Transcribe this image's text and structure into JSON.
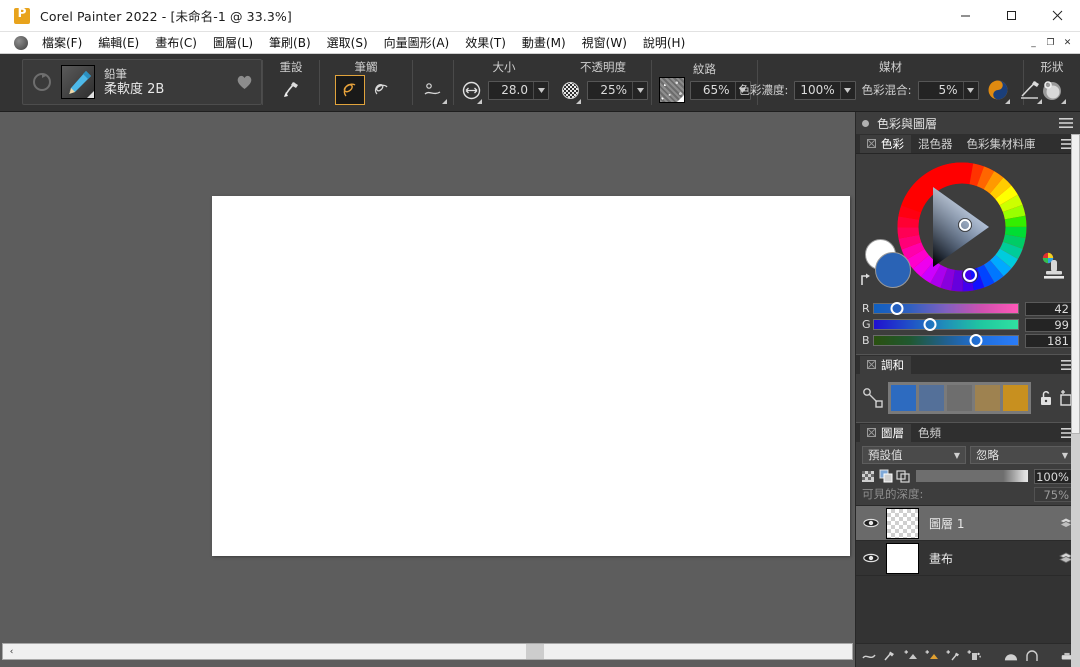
{
  "window": {
    "title": "Corel Painter 2022 - [未命名-1 @ 33.3%]",
    "logo_icon": "corel-painter-logo-icon",
    "minimize_label": "最小化",
    "maximize_label": "最大化",
    "close_label": "關閉",
    "doc_minimize": "_",
    "doc_restore": "❐",
    "doc_close": "✕"
  },
  "menubar": {
    "icon": "painter-document-icon",
    "items": [
      {
        "label": "檔案(F)"
      },
      {
        "label": "編輯(E)"
      },
      {
        "label": "畫布(C)"
      },
      {
        "label": "圖層(L)"
      },
      {
        "label": "筆刷(B)"
      },
      {
        "label": "選取(S)"
      },
      {
        "label": "向量圖形(A)"
      },
      {
        "label": "效果(T)"
      },
      {
        "label": "動畫(M)"
      },
      {
        "label": "視窗(W)"
      },
      {
        "label": "說明(H)"
      }
    ]
  },
  "propertybar": {
    "reset_brush_icon": "reset-circular-arrow-icon",
    "brush_category": "鉛筆",
    "brush_variant": "柔軟度 2B",
    "brush_thumb_icon": "pencil-brush-thumbnail-icon",
    "favorite_icon": "heart-icon",
    "reset_group": {
      "label": "重設",
      "icon": "reset-brush-tool-icon"
    },
    "stroke_group": {
      "label": "筆觸",
      "freehand_icon": "freehand-stroke-icon",
      "straight_icon": "straight-line-stroke-icon",
      "settings_icon": "stroke-settings-icon"
    },
    "size_group": {
      "label": "大小",
      "icon": "size-arrows-icon",
      "value": "28.0"
    },
    "opacity_group": {
      "label": "不透明度",
      "icon": "opacity-checker-icon",
      "value": "25%"
    },
    "grain_group": {
      "label": "紋路",
      "icon": "paper-texture-thumbnail-icon",
      "value": "65%"
    },
    "media_group": {
      "label": "媒材",
      "color_density_label": "色彩濃度:",
      "color_density_value": "100%",
      "color_blend_label": "色彩混合:",
      "color_blend_value": "5%",
      "blend_icon": "color-blend-sphere-icon",
      "media_brush_icon": "media-brush-icon"
    },
    "shape_group": {
      "label": "形狀",
      "icon": "shape-dab-icon"
    }
  },
  "canvas": {
    "hscroll_left_arrow": "‹"
  },
  "dock": {
    "color_layers_panel": {
      "title": "色彩與圖層",
      "menu_icon": "panel-menu-burger-icon",
      "tabs": [
        {
          "label": "色彩",
          "active": true,
          "close_icon": "tab-close-icon"
        },
        {
          "label": "混色器",
          "active": false
        },
        {
          "label": "色彩集材料庫",
          "active": false
        }
      ],
      "wheel_icon": "hue-saturation-color-wheel-icon",
      "main_color_swatch": "#2a63b5",
      "secondary_color_swatch": "#ffffff",
      "swap_colors_icon": "swap-colors-icon",
      "clone_color_icon": "clone-color-stamp-icon",
      "rgb": [
        {
          "label": "R",
          "value": "42",
          "position": 16
        },
        {
          "label": "G",
          "value": "99",
          "position": 39
        },
        {
          "label": "B",
          "value": "181",
          "position": 71
        }
      ]
    },
    "harmony_panel": {
      "title": "調和",
      "close_icon": "tab-close-icon",
      "menu_icon": "panel-menu-burger-icon",
      "link_icon": "harmony-link-icon",
      "swatches": [
        "#2d6bc0",
        "#547099",
        "#6e6e6e",
        "#9e8250",
        "#c8901f"
      ],
      "lock_icon": "lock-open-icon",
      "add_swatch_icon": "add-square-icon"
    },
    "layers_panel": {
      "tabs": [
        {
          "label": "圖層",
          "active": true,
          "close_icon": "tab-close-icon"
        },
        {
          "label": "色頻",
          "active": false
        }
      ],
      "menu_icon": "panel-menu-burger-icon",
      "blend_mode": "預設值",
      "ignore_mode": "忽略",
      "preserve_transparency_icon": "preserve-transparency-icon",
      "pick_up_underlying_icon": "pick-up-underlying-color-icon",
      "lock_layer_icon": "lock-layer-icon",
      "opacity_value": "100%",
      "depth_label": "可見的深度:",
      "depth_value": "75%",
      "rows": [
        {
          "name": "圖層 1",
          "selected": true,
          "thumb": "checker",
          "eye_icon": "eye-visible-icon",
          "kind_icon": "layer-stack-icon"
        },
        {
          "name": "畫布",
          "selected": false,
          "thumb": "white",
          "eye_icon": "eye-visible-icon",
          "kind_icon": "layer-stack-icon"
        }
      ],
      "toolbar_icons": [
        "new-watercolor-layer-icon",
        "new-liquid-ink-layer-icon",
        "new-layer-icon",
        "new-media-layer-icon",
        "new-dynamic-layer-icon",
        "layer-mask-icon",
        "group-layers-icon",
        "layer-effects-icon",
        "delete-layer-icon"
      ]
    }
  }
}
